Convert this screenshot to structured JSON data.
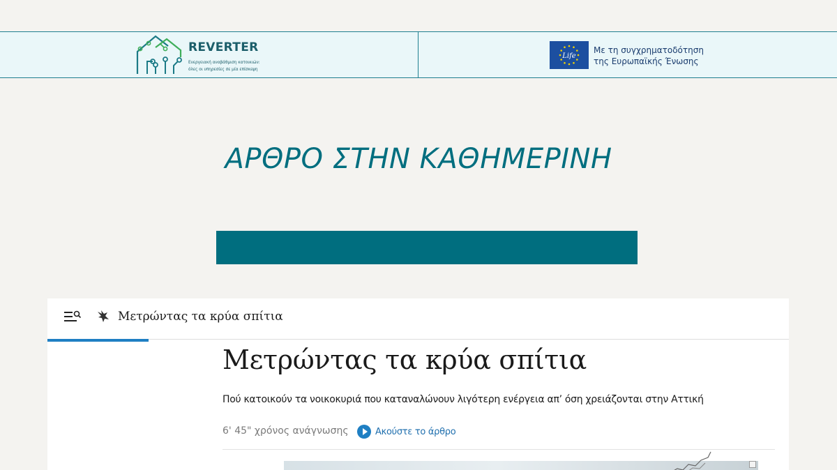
{
  "header": {
    "reverter": {
      "title": "REVERTER",
      "tagline_line1": "Ενεργειακή αναβάθμιση κατοικιών:",
      "tagline_line2": "όλες οι υπηρεσίες σε μία επίσκεψη",
      "icon": "house-circuit-icon"
    },
    "eu": {
      "logo_text": "Life",
      "line1": "Με τη συγχρηματοδότηση",
      "line2": "της Ευρωπαϊκής Ένωσης",
      "icon": "eu-life-flag-icon"
    }
  },
  "slide": {
    "heading": "ΑΡΘΡΟ ΣΤΗΝ ΚΑΘΗΜΕΡΙΝΗ"
  },
  "article_screenshot": {
    "topbar_title": "Μετρώντας τα κρύα σπίτια",
    "title": "Μετρώντας τα κρύα σπίτια",
    "subtitle": "Πού κατοικούν τα νοικοκυριά που καταναλώνουν λιγότερη ενέργεια απ’ όση χρειάζονται στην Αττική",
    "read_time": "6' 45\" χρόνος ανάγνωσης",
    "listen_label": "Ακούστε το άρθρο"
  },
  "colors": {
    "accent_teal": "#006e7f",
    "banner_bg": "#eaf7f9",
    "link_blue": "#1f7fc3",
    "eu_blue": "#1c4fa0"
  }
}
